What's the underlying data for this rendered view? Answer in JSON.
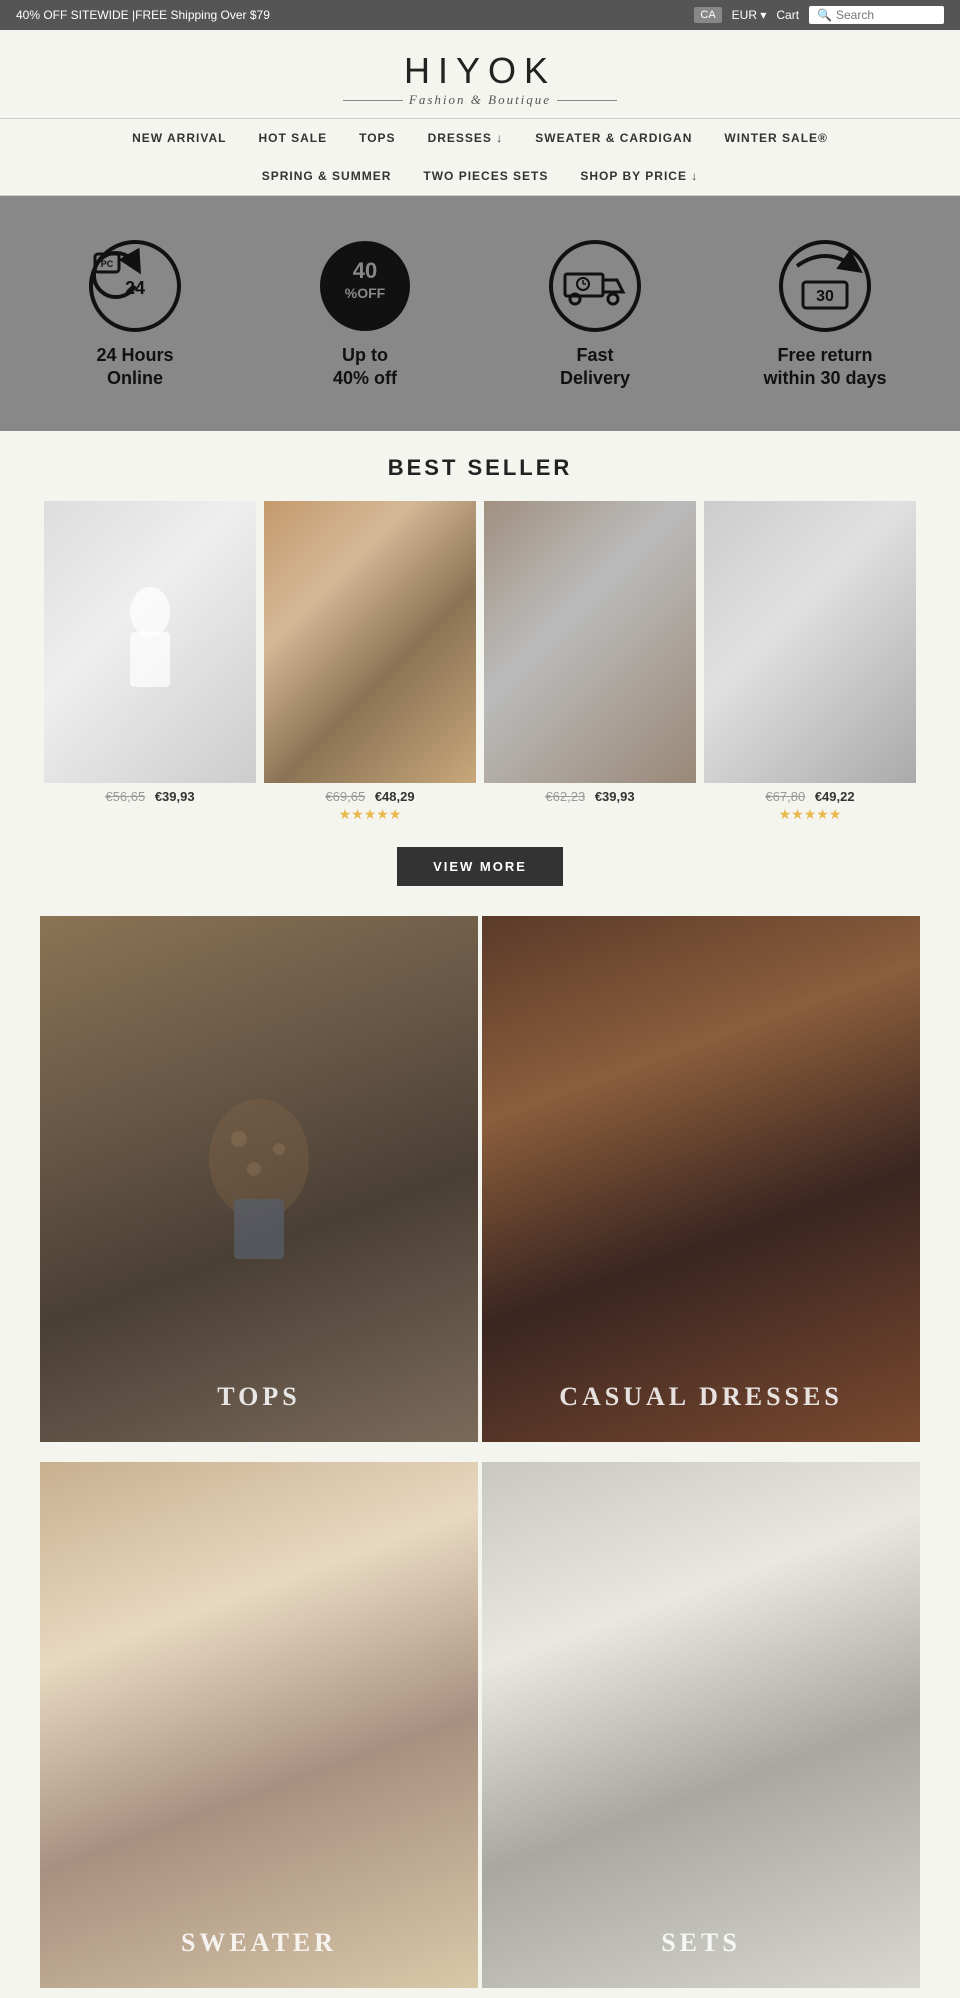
{
  "topBanner": {
    "promoText": "40% OFF SITEWIDE |FREE Shipping Over $79",
    "langLabel": "CA",
    "currencyLabel": "EUR ▾",
    "cartLabel": "Cart",
    "searchPlaceholder": "Search"
  },
  "logo": {
    "title": "HIYOK",
    "subtitle": "Fashion & Boutique"
  },
  "nav": {
    "row1": [
      {
        "label": "NEW ARRIVAL"
      },
      {
        "label": "HOT SALE"
      },
      {
        "label": "TOPS"
      },
      {
        "label": "DRESSES ↓"
      },
      {
        "label": "SWEATER & CARDIGAN"
      },
      {
        "label": "WINTER SALE®"
      }
    ],
    "row2": [
      {
        "label": "SPRING & SUMMER"
      },
      {
        "label": "TWO PIECES SETS"
      },
      {
        "label": "SHOP BY PRICE ↓"
      }
    ]
  },
  "features": [
    {
      "icon": "clock-24",
      "label": "24 Hours\nOnline"
    },
    {
      "icon": "percent-40",
      "label": "Up to\n40% off"
    },
    {
      "icon": "truck-fast",
      "label": "Fast\nDelivery"
    },
    {
      "icon": "return-30",
      "label": "Free return\nwithin 30 days"
    }
  ],
  "bestSeller": {
    "title": "BEST SELLER",
    "products": [
      {
        "oldPrice": "€56,65",
        "newPrice": "€39,93",
        "stars": 0,
        "color": "prod1"
      },
      {
        "oldPrice": "€69,65",
        "newPrice": "€48,29",
        "stars": 5,
        "color": "prod2"
      },
      {
        "oldPrice": "€62,23",
        "newPrice": "€39,93",
        "stars": 0,
        "color": "prod3"
      },
      {
        "oldPrice": "€67,80",
        "newPrice": "€49,22",
        "stars": 5,
        "color": "prod4"
      }
    ],
    "viewMoreLabel": "VIEW MORE"
  },
  "categories": [
    {
      "label": "TOPS",
      "colorClass": "cat-tops"
    },
    {
      "label": "CASUAL DRESSES",
      "colorClass": "cat-dresses"
    },
    {
      "label": "SWEATER",
      "colorClass": "cat-sweater"
    },
    {
      "label": "SETS",
      "colorClass": "cat-sets"
    }
  ]
}
